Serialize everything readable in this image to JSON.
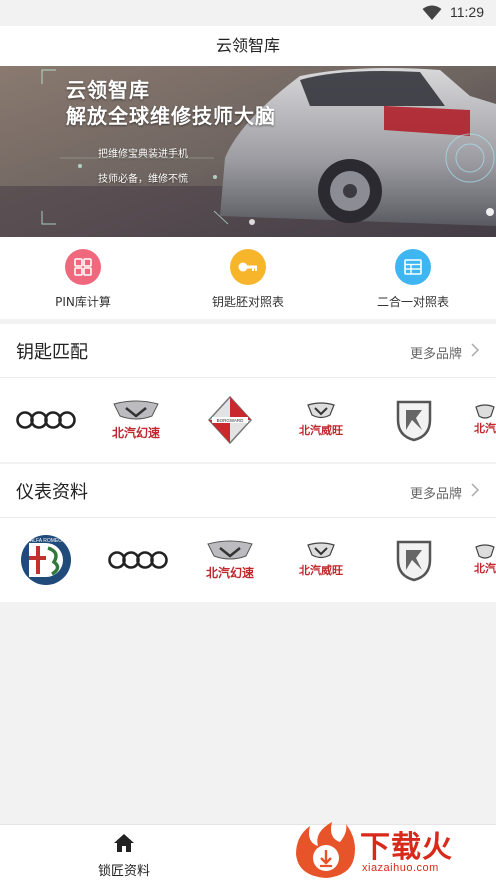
{
  "status_bar": {
    "time": "11:29",
    "wifi_icon": "wifi-icon"
  },
  "app": {
    "title": "云领智库"
  },
  "banner": {
    "title": "云领智库",
    "subtitle": "解放全球维修技师大脑",
    "line1": "把维修宝典装进手机",
    "line2": "技师必备，维修不慌"
  },
  "quick_actions": [
    {
      "label": "PIN库计算",
      "icon": "calculator-icon",
      "color": "#f0687d"
    },
    {
      "label": "钥匙胚对照表",
      "icon": "key-icon",
      "color": "#f7b52c"
    },
    {
      "label": "二合一对照表",
      "icon": "table-icon",
      "color": "#3db6f2"
    }
  ],
  "key_match": {
    "title": "钥匙匹配",
    "more": "更多品牌",
    "brands": [
      "audi-logo",
      "beiqi-huansu-logo",
      "borgward-logo",
      "beiqi-weiwang-logo",
      "baic-logo",
      "baic-logo-partial"
    ],
    "brand_texts": {
      "beiqi_huansu": "北汽幻速",
      "beiqi_weiwang": "北汽威旺",
      "borgward": "BORGWARD",
      "baic": "北汽"
    }
  },
  "dashboard": {
    "title": "仪表资料",
    "more": "更多品牌",
    "brands": [
      "alfa-romeo-logo",
      "audi-logo",
      "beiqi-huansu-logo",
      "beiqi-weiwang-logo",
      "baic-logo",
      "baic-logo-partial"
    ],
    "brand_texts": {
      "alfa_romeo": "ALFA ROMEO",
      "beiqi_huansu": "北汽幻速",
      "beiqi_weiwang": "北汽威旺",
      "baic": "北汽"
    }
  },
  "tabbar": {
    "tab1_label": "锁匠资料",
    "tab1_icon": "home-icon"
  },
  "watermark": {
    "text": "下载火",
    "url": "xiazaihuo.com"
  }
}
